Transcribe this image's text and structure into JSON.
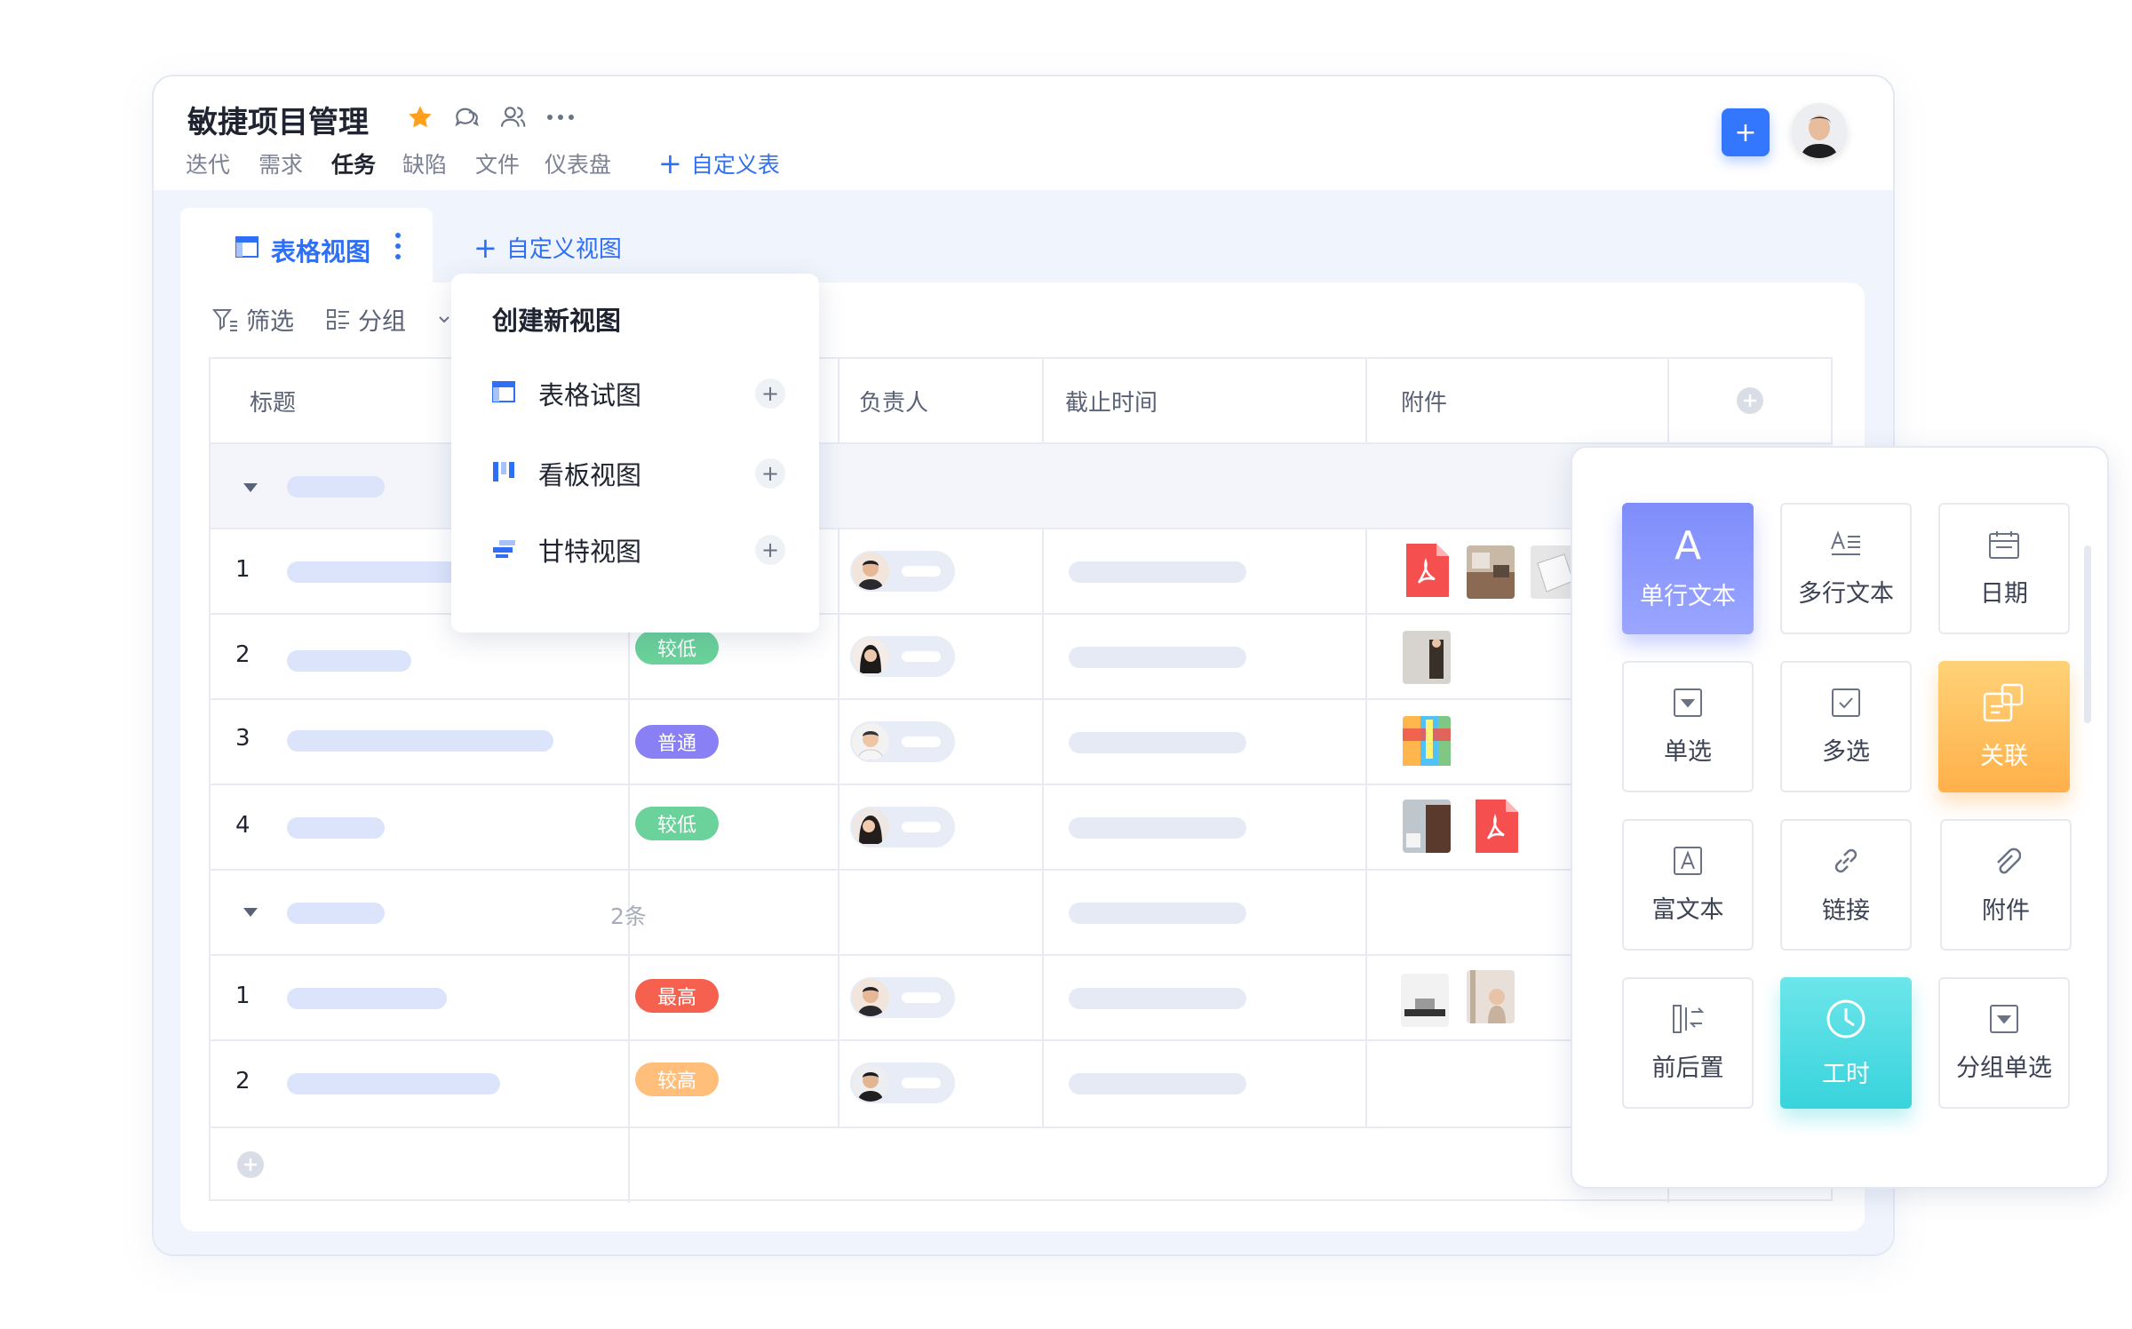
{
  "project": {
    "title": "敏捷项目管理",
    "tabs": [
      "迭代",
      "需求",
      "任务",
      "缺陷",
      "文件",
      "仪表盘"
    ],
    "active_tab": "任务",
    "add_table_label": "自定义表"
  },
  "view_tabs": {
    "current": "表格视图",
    "add_view_label": "自定义视图"
  },
  "toolbar": {
    "filter_label": "筛选",
    "group_label": "分组"
  },
  "table": {
    "columns": [
      "标题",
      "负责人",
      "截止时间",
      "附件"
    ],
    "group2_count": "2条",
    "rows": [
      {
        "num": "1",
        "priority": ""
      },
      {
        "num": "2",
        "priority": "较低"
      },
      {
        "num": "3",
        "priority": "普通"
      },
      {
        "num": "4",
        "priority": "较低"
      },
      {
        "num": "1",
        "priority": "最高"
      },
      {
        "num": "2",
        "priority": "较高"
      }
    ]
  },
  "dropdown": {
    "title": "创建新视图",
    "items": [
      "表格试图",
      "看板视图",
      "甘特视图"
    ]
  },
  "field_types": [
    "单行文本",
    "多行文本",
    "日期",
    "单选",
    "多选",
    "关联",
    "富文本",
    "链接",
    "附件",
    "前后置",
    "工时",
    "分组单选"
  ],
  "colors": {
    "accent": "#2f6ff5",
    "priority_low": "#6ad29a",
    "priority_normal": "#8a80f5",
    "priority_highest": "#f5604f",
    "priority_high": "#ffbe7a"
  }
}
